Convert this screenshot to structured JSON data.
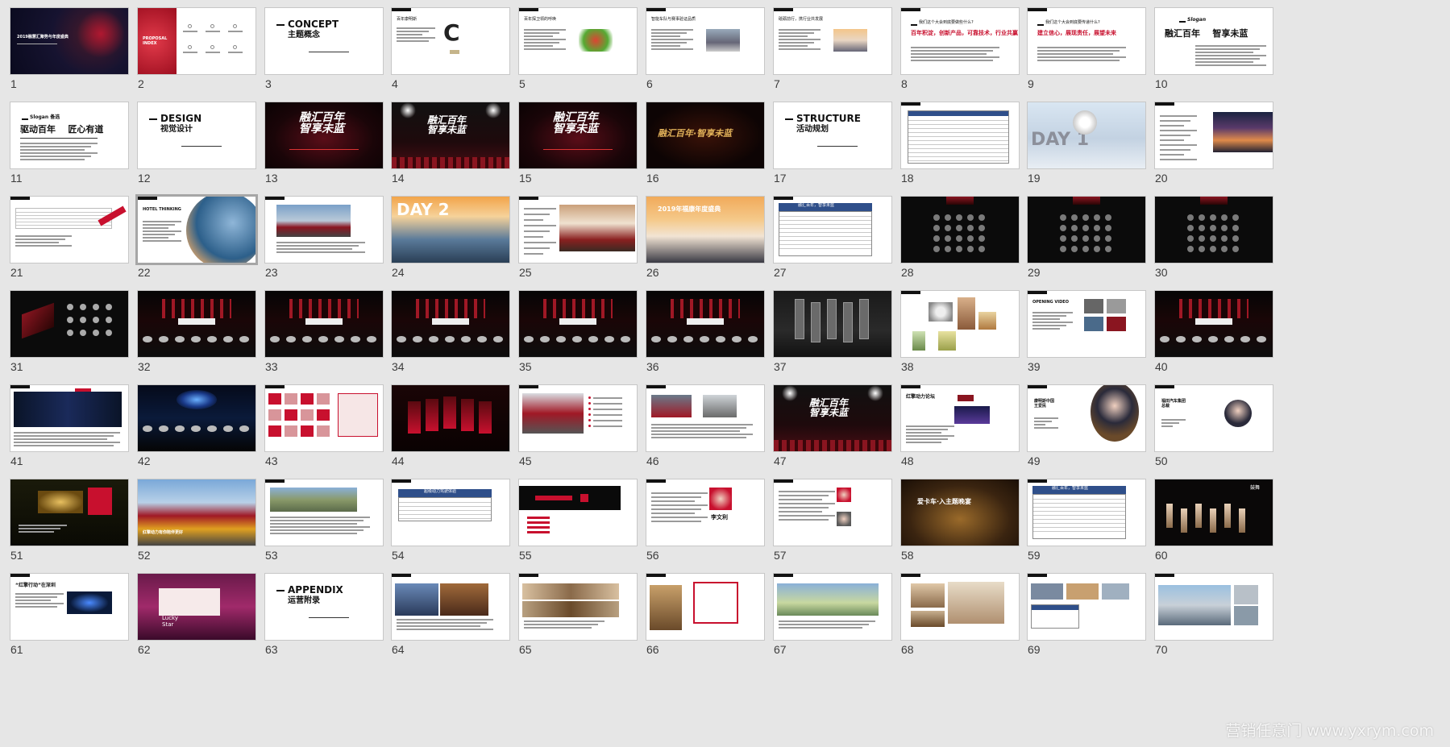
{
  "window": {
    "view": "slide-sorter"
  },
  "watermark": "营销任意门 www.yxrym.com",
  "colors": {
    "background": "#e6e6e6",
    "brand_red": "#c8102e",
    "thumb_border": "#c7c7c7"
  },
  "slides": [
    {
      "n": "1",
      "kind": "cover",
      "title": "2019融慧汇聚势与年度盛典"
    },
    {
      "n": "2",
      "kind": "red-left",
      "title": "PROPOSAL\nINDEX"
    },
    {
      "n": "3",
      "kind": "section",
      "title": "CONCEPT",
      "sub": "主题概念"
    },
    {
      "n": "4",
      "kind": "doc-logo",
      "title": "百年康明斯"
    },
    {
      "n": "5",
      "kind": "doc-img",
      "title": "百年探卫领的呼唤",
      "img": "veg"
    },
    {
      "n": "6",
      "kind": "doc-img",
      "title": "智能车队与赛事验证品质",
      "img": "road"
    },
    {
      "n": "7",
      "kind": "doc-img",
      "title": "砥砺前行，携行业共发展",
      "img": "sunset"
    },
    {
      "n": "8",
      "kind": "question",
      "title": "我们这个大会到底要做些什么?",
      "sub": "百年积淀，创新产品，可靠技术，行业共赢"
    },
    {
      "n": "9",
      "kind": "question",
      "title": "我们这个大会到底要传递什么?",
      "sub": "建立信心，展现责任，展望未来"
    },
    {
      "n": "10",
      "kind": "slogan-r",
      "title": "Slogan",
      "sub": "融汇百年    智享未蓝"
    },
    {
      "n": "11",
      "kind": "slogan-l",
      "title": "Slogan 备选",
      "sub": "驱动百年    匠心有道"
    },
    {
      "n": "12",
      "kind": "section",
      "title": "DESIGN",
      "sub": "视觉设计"
    },
    {
      "n": "13",
      "kind": "kv",
      "title": "融汇百年\n智享未蓝"
    },
    {
      "n": "14",
      "kind": "kv-stage",
      "title": "融汇百年\n智享未蓝"
    },
    {
      "n": "15",
      "kind": "kv",
      "title": "融汇百年\n智享未蓝"
    },
    {
      "n": "16",
      "kind": "kv-gold",
      "title": "融汇百年·智享未蓝"
    },
    {
      "n": "17",
      "kind": "section",
      "title": "STRUCTURE",
      "sub": "活动规划"
    },
    {
      "n": "18",
      "kind": "table"
    },
    {
      "n": "19",
      "kind": "day1",
      "title": "DAY 1"
    },
    {
      "n": "20",
      "kind": "city-right"
    },
    {
      "n": "21",
      "kind": "sheet"
    },
    {
      "n": "22",
      "kind": "hotel",
      "title": "HOTEL THINKING"
    },
    {
      "n": "23",
      "kind": "photo-trucks"
    },
    {
      "n": "24",
      "kind": "day2",
      "title": "DAY 2"
    },
    {
      "n": "25",
      "kind": "meeting"
    },
    {
      "n": "26",
      "kind": "audience",
      "title": "2019年福康年度盛典"
    },
    {
      "n": "27",
      "kind": "table-blue",
      "title": "融汇百年，智享未蓝"
    },
    {
      "n": "28",
      "kind": "venue"
    },
    {
      "n": "29",
      "kind": "venue"
    },
    {
      "n": "30",
      "kind": "venue"
    },
    {
      "n": "31",
      "kind": "venue-top"
    },
    {
      "n": "32",
      "kind": "stage"
    },
    {
      "n": "33",
      "kind": "stage"
    },
    {
      "n": "34",
      "kind": "stage"
    },
    {
      "n": "35",
      "kind": "stage"
    },
    {
      "n": "36",
      "kind": "stage"
    },
    {
      "n": "37",
      "kind": "hall"
    },
    {
      "n": "38",
      "kind": "food"
    },
    {
      "n": "39",
      "kind": "video",
      "title": "OPENING VIDEO"
    },
    {
      "n": "40",
      "kind": "stage"
    },
    {
      "n": "41",
      "kind": "diagram-dark"
    },
    {
      "n": "42",
      "kind": "stage-blue"
    },
    {
      "n": "43",
      "kind": "collage-red"
    },
    {
      "n": "44",
      "kind": "stage-red"
    },
    {
      "n": "45",
      "kind": "trucks-list"
    },
    {
      "n": "46",
      "kind": "trucks-list2"
    },
    {
      "n": "47",
      "kind": "kv-stage",
      "title": "融汇百年\n智享未蓝"
    },
    {
      "n": "48",
      "kind": "forum",
      "title": "红擎动力论坛"
    },
    {
      "n": "49",
      "kind": "speaker",
      "title": "康明斯中国\n王爱民"
    },
    {
      "n": "50",
      "kind": "speaker2",
      "title": "福田汽车集团\n总裁"
    },
    {
      "n": "51",
      "kind": "stage-gold"
    },
    {
      "n": "52",
      "kind": "trucks-big",
      "title": "红擎动力有你陪伴更好"
    },
    {
      "n": "53",
      "kind": "field"
    },
    {
      "n": "54",
      "kind": "table-blue2",
      "title": "超级动力驾驶体验"
    },
    {
      "n": "55",
      "kind": "red-timeline"
    },
    {
      "n": "56",
      "kind": "person",
      "title": "李文利"
    },
    {
      "n": "57",
      "kind": "people"
    },
    {
      "n": "58",
      "kind": "dinner",
      "title": "爱卡车·入主题晚宴"
    },
    {
      "n": "59",
      "kind": "table-blue",
      "title": "融汇百年，智享未蓝"
    },
    {
      "n": "60",
      "kind": "dancers",
      "title": "鼓舞"
    },
    {
      "n": "61",
      "kind": "sign",
      "title": "“红擎行动”在深圳"
    },
    {
      "n": "62",
      "kind": "lucky",
      "title": "Lucky\nStar"
    },
    {
      "n": "63",
      "kind": "section",
      "title": "APPENDIX",
      "sub": "运营附录"
    },
    {
      "n": "64",
      "kind": "hotel-a"
    },
    {
      "n": "65",
      "kind": "hotel-b"
    },
    {
      "n": "66",
      "kind": "hotel-plan"
    },
    {
      "n": "67",
      "kind": "hotel-c"
    },
    {
      "n": "68",
      "kind": "hotel-d"
    },
    {
      "n": "69",
      "kind": "hotel-e"
    },
    {
      "n": "70",
      "kind": "hotel-f"
    }
  ]
}
